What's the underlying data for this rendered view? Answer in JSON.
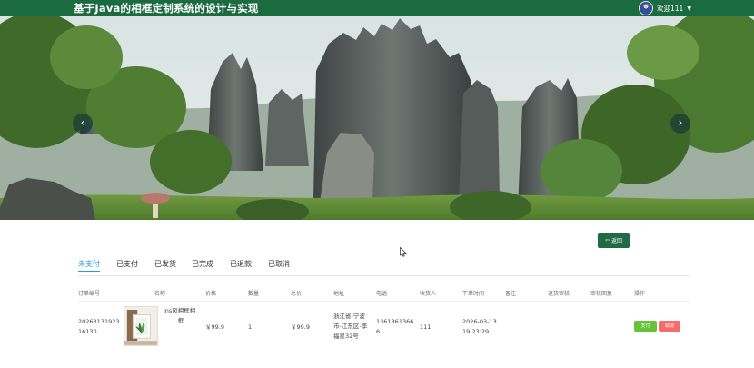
{
  "header": {
    "title": "基于Java的相框定制系统的设计与实现",
    "welcome": "欢迎111",
    "caret": "▼"
  },
  "banner": {
    "prev_icon": "‹",
    "next_icon": "›",
    "slide_index": 1,
    "slide_count": 1
  },
  "back_button": {
    "icon": "⇦",
    "label": "返回"
  },
  "tabs": [
    {
      "label": "未支付",
      "active": true
    },
    {
      "label": "已支付",
      "active": false
    },
    {
      "label": "已发货",
      "active": false
    },
    {
      "label": "已完成",
      "active": false
    },
    {
      "label": "已退款",
      "active": false
    },
    {
      "label": "已取消",
      "active": false
    }
  ],
  "table": {
    "columns": [
      "订单编号",
      "名称",
      "价格",
      "数量",
      "总价",
      "地址",
      "电话",
      "收货人",
      "下单时间",
      "备注",
      "退货审核",
      "审核回复",
      "操作"
    ],
    "rows": [
      {
        "order_no_line1": "20263131923",
        "order_no_line2": "16130",
        "name_line1": "ins风相框相",
        "name_line2": "框",
        "price": "￥99.9",
        "quantity": "1",
        "total": "￥99.9",
        "address_line1": "浙江省-宁波",
        "address_line2": "市-江东区-李",
        "address_line3": "福星32号",
        "phone_line1": "1361361366",
        "phone_line2": "6",
        "receiver": "111",
        "time_line1": "2026-03-13",
        "time_line2": "19:23:29",
        "pay_label": "支付",
        "cancel_label": "取消"
      }
    ]
  },
  "colors": {
    "header_bg": "#1a6b3f",
    "tab_active": "#2e9bd6",
    "back_button": "#1f6b44",
    "pay_button": "#67c23a",
    "cancel_button": "#f56c6c"
  },
  "icons": {
    "user": "avatar-icon",
    "prev": "chevron-left-icon",
    "next": "chevron-right-icon",
    "back": "arrow-left-icon"
  }
}
